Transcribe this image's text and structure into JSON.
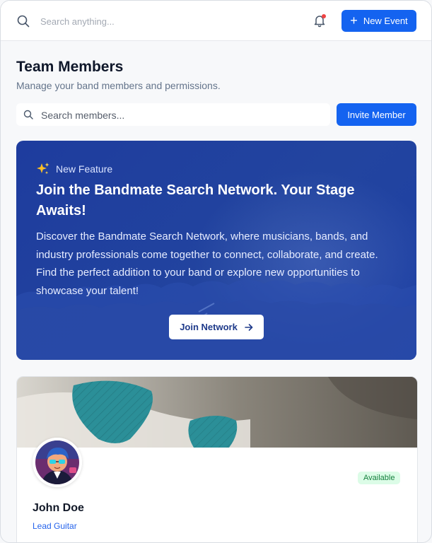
{
  "topbar": {
    "search_placeholder": "Search anything...",
    "new_event_label": "New Event",
    "notification_dot_color": "#ef4444"
  },
  "page": {
    "title": "Team Members",
    "subtitle": "Manage your band members and permissions."
  },
  "members_toolbar": {
    "search_placeholder": "Search members...",
    "invite_label": "Invite Member"
  },
  "banner": {
    "badge_icon": "sparkle-icon",
    "badge_label": "New Feature",
    "title": "Join the Bandmate Search Network. Your Stage Awaits!",
    "body": "Discover the Bandmate Search Network, where musicians, bands, and industry professionals come together to connect, collaborate, and create. Find the perfect addition to your band or explore new opportunities to showcase your talent!",
    "cta_label": "Join Network"
  },
  "member_card": {
    "name": "John Doe",
    "role": "Lead Guitar",
    "status": "Available"
  },
  "colors": {
    "accent": "#1463f0",
    "banner": "#1e40a4",
    "available_bg": "#dcfce7",
    "available_text": "#15803d"
  }
}
